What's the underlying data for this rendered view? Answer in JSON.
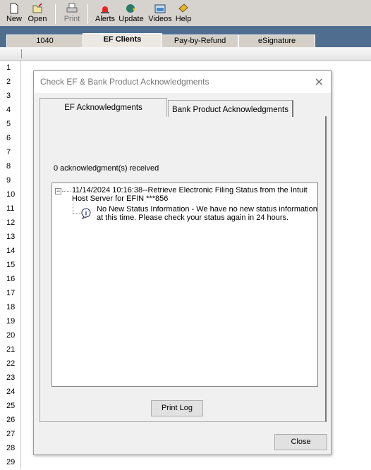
{
  "toolbar": {
    "items": [
      {
        "label": "New",
        "icon": "new-document-icon"
      },
      {
        "label": "Open",
        "icon": "open-folder-icon"
      },
      {
        "label": "Print",
        "icon": "printer-icon"
      },
      {
        "label": "Alerts",
        "icon": "alert-siren-icon"
      },
      {
        "label": "Update",
        "icon": "update-globe-icon"
      },
      {
        "label": "Videos",
        "icon": "video-icon"
      },
      {
        "label": "Help",
        "icon": "help-book-icon"
      }
    ]
  },
  "window_tabs": [
    "1040",
    "EF Clients",
    "Pay-by-Refund",
    "eSignature"
  ],
  "row_numbers": [
    "1",
    "2",
    "3",
    "4",
    "5",
    "6",
    "7",
    "8",
    "9",
    "10",
    "11",
    "12",
    "13",
    "14",
    "15",
    "16",
    "17",
    "18",
    "19",
    "20",
    "21",
    "22",
    "23",
    "24",
    "25",
    "26",
    "27",
    "28",
    "29"
  ],
  "dialog": {
    "title": "Check EF & Bank Product Acknowledgments",
    "tabs": [
      "EF Acknowledgments",
      "Bank Product Acknowledgments"
    ],
    "count_label": "0 acknowledgment(s) received",
    "log": {
      "header_line1": "11/14/2024 10:16:38--Retrieve Electronic Filing Status from the Intuit",
      "header_line2": "Host Server for EFIN ***856",
      "message_line1": "No New Status Information - We have no new status information",
      "message_line2": "at this time. Please check your status again in 24 hours."
    },
    "print_log": "Print Log",
    "close": "Close"
  }
}
